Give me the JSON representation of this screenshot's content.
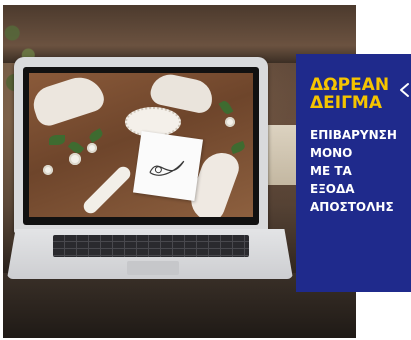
{
  "promo": {
    "headline_lines": [
      "ΔΩΡΕΑΝ",
      "ΔΕΙΓΜΑ"
    ],
    "body_lines": [
      "ΕΠΙΒΑΡΥΝΣΗ",
      "ΜΟΝΟ",
      "ΜΕ ΤΑ",
      "ΕΞΟΔΑ",
      "ΑΠΟΣΤΟΛΗΣ"
    ],
    "arrow_icon": "arrow-left-icon",
    "background_color": "#1f2a8c",
    "headline_color": "#f5c400",
    "body_color": "#ffffff"
  },
  "photo": {
    "subject": "laptop-icon",
    "screen_content": "wedding-accessories-icon"
  }
}
